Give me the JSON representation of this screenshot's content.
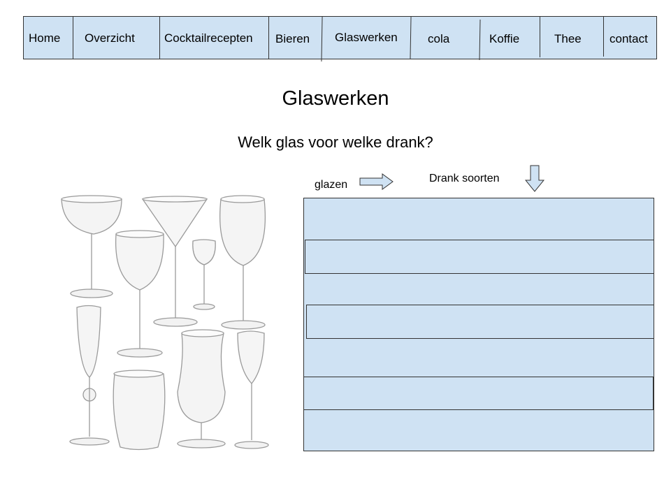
{
  "nav": {
    "items": [
      "Home",
      "Overzicht",
      "Cocktailrecepten",
      "Bieren",
      "Glaswerken",
      "cola",
      "Koffie",
      "Thee",
      "contact"
    ]
  },
  "page": {
    "title": "Glaswerken",
    "subtitle": "Welk glas voor welke drank?"
  },
  "labels": {
    "glazen": "glazen",
    "drank_soorten": "Drank soorten"
  },
  "icons": {
    "right_arrow": "arrow-right-icon",
    "down_arrow": "arrow-down-icon"
  },
  "colors": {
    "panel_fill": "#cfe2f3",
    "border": "#333333"
  }
}
